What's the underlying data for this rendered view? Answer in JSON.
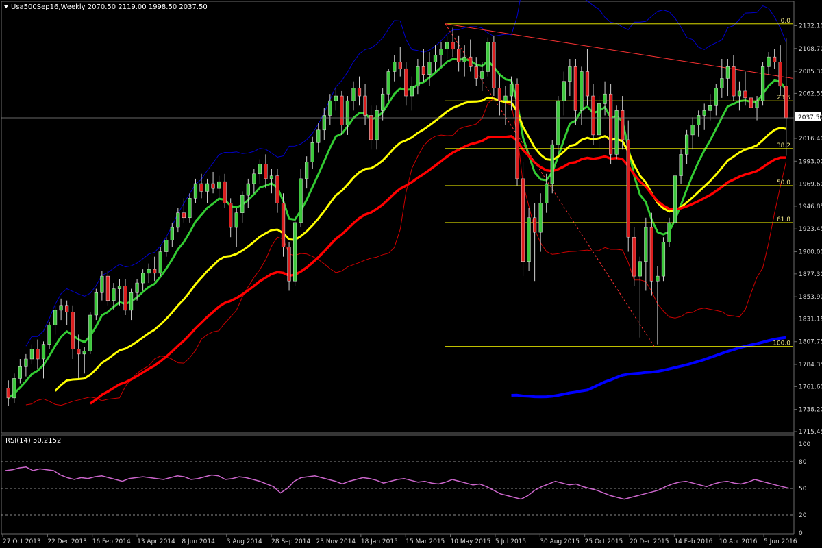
{
  "header": {
    "symbol_line": "Usa500Sep16,Weekly  2070.50 2119.00 1998.50 2037.50"
  },
  "rsi_header": "RSI(14) 50.2152",
  "colors": {
    "background": "#000000",
    "bull_candle": "#3cc83c",
    "bear_candle": "#dc1e1e",
    "bb_upper": "#0000cc",
    "bb_lower": "#cc0000",
    "ema_green": "#33cc33",
    "ema_yellow": "#ffff00",
    "ema_red": "#ff0000",
    "ma_blue": "#0000ff",
    "trendline": "#ff3333",
    "fib": "#ffff00",
    "rsi": "#cc66cc"
  },
  "chart_data": [
    {
      "type": "candlestick",
      "ylim": [
        1715.45,
        2143.0
      ],
      "y_ticks": [
        "2132.10",
        "2108.70",
        "2085.30",
        "2062.55",
        "2039.15",
        "2016.40",
        "1993.00",
        "1969.60",
        "1946.85",
        "1923.45",
        "1900.00",
        "1877.30",
        "1853.90",
        "1831.15",
        "1807.75",
        "1784.35",
        "1761.60",
        "1738.20",
        "1715.45"
      ],
      "current_price_label": "2037.50",
      "x_tick_labels": [
        "27 Oct 2013",
        "22 Dec 2013",
        "16 Feb 2014",
        "13 Apr 2014",
        "8 Jun 2014",
        "3 Aug 2014",
        "28 Sep 2014",
        "23 Nov 2014",
        "18 Jan 2015",
        "15 Mar 2015",
        "10 May 2015",
        "5 Jul 2015",
        "30 Aug 2015",
        "25 Oct 2015",
        "20 Dec 2015",
        "14 Feb 2016",
        "10 Apr 2016",
        "5 Jun 2016"
      ],
      "candles": [
        [
          1760,
          1768,
          1742,
          1750
        ],
        [
          1750,
          1775,
          1745,
          1770
        ],
        [
          1770,
          1790,
          1765,
          1782
        ],
        [
          1782,
          1795,
          1772,
          1790
        ],
        [
          1790,
          1805,
          1785,
          1800
        ],
        [
          1800,
          1810,
          1780,
          1790
        ],
        [
          1790,
          1808,
          1770,
          1805
        ],
        [
          1805,
          1828,
          1800,
          1825
        ],
        [
          1825,
          1845,
          1815,
          1840
        ],
        [
          1840,
          1852,
          1830,
          1845
        ],
        [
          1845,
          1850,
          1825,
          1838
        ],
        [
          1838,
          1845,
          1790,
          1800
        ],
        [
          1800,
          1815,
          1770,
          1795
        ],
        [
          1795,
          1802,
          1775,
          1798
        ],
        [
          1798,
          1838,
          1795,
          1835
        ],
        [
          1835,
          1862,
          1830,
          1858
        ],
        [
          1858,
          1880,
          1850,
          1875
        ],
        [
          1875,
          1880,
          1845,
          1850
        ],
        [
          1850,
          1868,
          1840,
          1862
        ],
        [
          1862,
          1872,
          1845,
          1865
        ],
        [
          1865,
          1872,
          1835,
          1840
        ],
        [
          1840,
          1862,
          1830,
          1858
        ],
        [
          1858,
          1872,
          1850,
          1868
        ],
        [
          1868,
          1882,
          1860,
          1878
        ],
        [
          1878,
          1888,
          1868,
          1882
        ],
        [
          1882,
          1895,
          1870,
          1878
        ],
        [
          1878,
          1905,
          1875,
          1900
        ],
        [
          1900,
          1915,
          1895,
          1912
        ],
        [
          1912,
          1930,
          1905,
          1925
        ],
        [
          1925,
          1945,
          1920,
          1940
        ],
        [
          1940,
          1955,
          1930,
          1935
        ],
        [
          1935,
          1960,
          1930,
          1955
        ],
        [
          1955,
          1975,
          1950,
          1970
        ],
        [
          1970,
          1980,
          1955,
          1962
        ],
        [
          1962,
          1975,
          1950,
          1970
        ],
        [
          1970,
          1982,
          1960,
          1965
        ],
        [
          1965,
          1978,
          1955,
          1972
        ],
        [
          1972,
          1980,
          1945,
          1950
        ],
        [
          1950,
          1955,
          1915,
          1925
        ],
        [
          1925,
          1945,
          1905,
          1940
        ],
        [
          1940,
          1962,
          1930,
          1958
        ],
        [
          1958,
          1975,
          1945,
          1970
        ],
        [
          1970,
          1985,
          1960,
          1980
        ],
        [
          1980,
          1995,
          1970,
          1990
        ],
        [
          1990,
          2000,
          1965,
          1975
        ],
        [
          1975,
          1985,
          1960,
          1978
        ],
        [
          1978,
          1985,
          1940,
          1950
        ],
        [
          1950,
          1960,
          1895,
          1905
        ],
        [
          1905,
          1910,
          1860,
          1870
        ],
        [
          1870,
          1935,
          1865,
          1930
        ],
        [
          1930,
          1985,
          1925,
          1975
        ],
        [
          1975,
          1998,
          1965,
          1992
        ],
        [
          1992,
          2018,
          1985,
          2012
        ],
        [
          2012,
          2032,
          2002,
          2025
        ],
        [
          2025,
          2048,
          2015,
          2040
        ],
        [
          2040,
          2062,
          2030,
          2055
        ],
        [
          2055,
          2068,
          2045,
          2060
        ],
        [
          2060,
          2065,
          2020,
          2030
        ],
        [
          2030,
          2060,
          2020,
          2055
        ],
        [
          2055,
          2075,
          2045,
          2068
        ],
        [
          2068,
          2080,
          2050,
          2060
        ],
        [
          2060,
          2072,
          2030,
          2040
        ],
        [
          2040,
          2050,
          2005,
          2015
        ],
        [
          2015,
          2050,
          2005,
          2045
        ],
        [
          2045,
          2068,
          2035,
          2062
        ],
        [
          2062,
          2088,
          2055,
          2085
        ],
        [
          2085,
          2102,
          2075,
          2095
        ],
        [
          2095,
          2110,
          2080,
          2088
        ],
        [
          2088,
          2095,
          2050,
          2060
        ],
        [
          2060,
          2080,
          2045,
          2070
        ],
        [
          2070,
          2098,
          2062,
          2090
        ],
        [
          2090,
          2108,
          2075,
          2082
        ],
        [
          2082,
          2105,
          2070,
          2095
        ],
        [
          2095,
          2112,
          2085,
          2102
        ],
        [
          2102,
          2115,
          2090,
          2108
        ],
        [
          2108,
          2122,
          2098,
          2115
        ],
        [
          2115,
          2130,
          2100,
          2108
        ],
        [
          2108,
          2122,
          2085,
          2095
        ],
        [
          2095,
          2112,
          2080,
          2100
        ],
        [
          2100,
          2118,
          2085,
          2090
        ],
        [
          2090,
          2100,
          2070,
          2078
        ],
        [
          2078,
          2095,
          2065,
          2085
        ],
        [
          2085,
          2120,
          2080,
          2115
        ],
        [
          2115,
          2122,
          2060,
          2068
        ],
        [
          2068,
          2082,
          2040,
          2055
        ],
        [
          2055,
          2070,
          2030,
          2060
        ],
        [
          2060,
          2080,
          2045,
          2072
        ],
        [
          2072,
          2078,
          1968,
          1975
        ],
        [
          1975,
          1992,
          1875,
          1890
        ],
        [
          1890,
          1945,
          1880,
          1935
        ],
        [
          1935,
          1950,
          1870,
          1920
        ],
        [
          1920,
          1960,
          1900,
          1950
        ],
        [
          1950,
          1980,
          1940,
          1970
        ],
        [
          1970,
          2015,
          1960,
          2010
        ],
        [
          2010,
          2060,
          2000,
          2055
        ],
        [
          2055,
          2085,
          2040,
          2075
        ],
        [
          2075,
          2098,
          2060,
          2090
        ],
        [
          2090,
          2098,
          2030,
          2045
        ],
        [
          2045,
          2090,
          2030,
          2085
        ],
        [
          2085,
          2108,
          2050,
          2060
        ],
        [
          2060,
          2072,
          2010,
          2020
        ],
        [
          2020,
          2060,
          2005,
          2052
        ],
        [
          2052,
          2075,
          2040,
          2062
        ],
        [
          2062,
          2072,
          1990,
          2000
        ],
        [
          2000,
          2050,
          1995,
          2045
        ],
        [
          2045,
          2060,
          2005,
          2015
        ],
        [
          2015,
          2035,
          1900,
          1915
        ],
        [
          1915,
          1925,
          1865,
          1875
        ],
        [
          1875,
          1895,
          1812,
          1890
        ],
        [
          1890,
          1935,
          1860,
          1925
        ],
        [
          1925,
          1940,
          1855,
          1870
        ],
        [
          1870,
          1885,
          1805,
          1875
        ],
        [
          1875,
          1915,
          1870,
          1910
        ],
        [
          1910,
          1935,
          1905,
          1930
        ],
        [
          1930,
          1982,
          1925,
          1978
        ],
        [
          1978,
          2005,
          1970,
          2000
        ],
        [
          2000,
          2025,
          1990,
          2020
        ],
        [
          2020,
          2038,
          2005,
          2030
        ],
        [
          2030,
          2045,
          2018,
          2040
        ],
        [
          2040,
          2052,
          2025,
          2045
        ],
        [
          2045,
          2062,
          2035,
          2050
        ],
        [
          2050,
          2072,
          2040,
          2068
        ],
        [
          2068,
          2098,
          2058,
          2078
        ],
        [
          2078,
          2098,
          2060,
          2090
        ],
        [
          2090,
          2102,
          2055,
          2060
        ],
        [
          2060,
          2075,
          2045,
          2065
        ],
        [
          2065,
          2085,
          2050,
          2058
        ],
        [
          2058,
          2070,
          2040,
          2048
        ],
        [
          2048,
          2060,
          2035,
          2055
        ],
        [
          2055,
          2095,
          2050,
          2090
        ],
        [
          2090,
          2105,
          2082,
          2100
        ],
        [
          2100,
          2108,
          2088,
          2095
        ],
        [
          2095,
          2112,
          2060,
          2070
        ],
        [
          2070,
          2119,
          1998.5,
          2037.5
        ]
      ],
      "fibonacci_levels": [
        {
          "label": "0.0",
          "price": 2134
        },
        {
          "label": "23.6",
          "price": 2055
        },
        {
          "label": "38.2",
          "price": 2006
        },
        {
          "label": "50.0",
          "price": 1968
        },
        {
          "label": "61.8",
          "price": 1930
        },
        {
          "label": "100.0",
          "price": 1803
        }
      ]
    },
    {
      "type": "line",
      "title": "RSI(14) 50.2152",
      "ylim": [
        0,
        100
      ],
      "y_ticks": [
        "100",
        "80",
        "50",
        "20",
        "0"
      ],
      "levels": [
        80,
        50,
        20
      ],
      "values": [
        70,
        71,
        73,
        74,
        70,
        72,
        71,
        70,
        65,
        62,
        60,
        62,
        61,
        63,
        64,
        62,
        60,
        58,
        61,
        62,
        63,
        62,
        61,
        60,
        62,
        64,
        63,
        60,
        61,
        63,
        65,
        64,
        60,
        61,
        63,
        62,
        60,
        58,
        55,
        52,
        45,
        50,
        58,
        62,
        63,
        64,
        62,
        60,
        58,
        55,
        58,
        60,
        62,
        61,
        59,
        56,
        58,
        60,
        61,
        59,
        57,
        58,
        56,
        55,
        57,
        60,
        58,
        56,
        54,
        55,
        52,
        48,
        44,
        42,
        40,
        38,
        42,
        48,
        52,
        55,
        58,
        56,
        54,
        55,
        52,
        50,
        48,
        45,
        42,
        40,
        38,
        40,
        42,
        44,
        46,
        48,
        52,
        55,
        57,
        58,
        56,
        54,
        52,
        55,
        57,
        58,
        56,
        55,
        57,
        60,
        58,
        56,
        54,
        52,
        50.2
      ]
    }
  ]
}
